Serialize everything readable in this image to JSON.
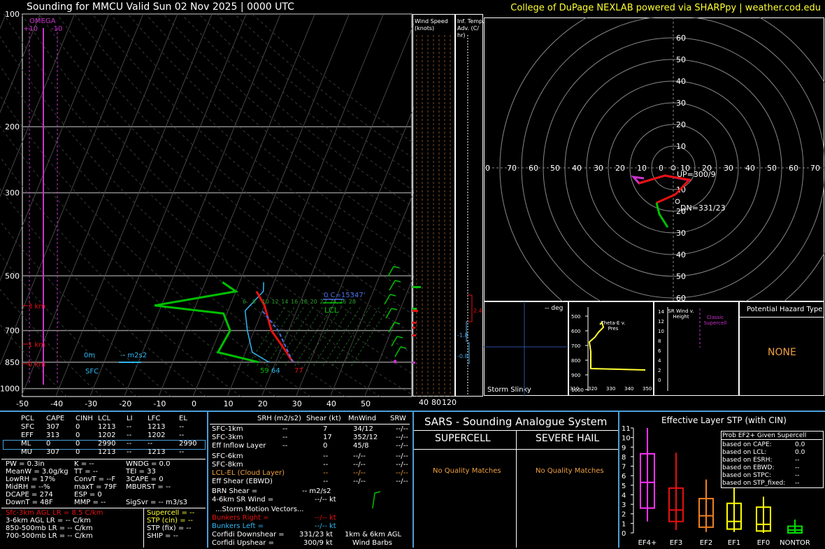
{
  "header": {
    "title": "Sounding for MMCU Valid  Sun 02 Nov 2025 | 0000 UTC",
    "credit": "College of DuPage NEXLAB powered via SHARPpy | weather.cod.edu"
  },
  "skewt": {
    "pressure_labels": [
      "100",
      "200",
      "300",
      "500",
      "700",
      "850",
      "1000"
    ],
    "temp_labels": [
      "-50",
      "-40",
      "-30",
      "-20",
      "-10",
      "0",
      "10",
      "20",
      "30",
      "40",
      "50"
    ],
    "omega_label": "OMEGA",
    "omega_ticks": [
      "+10",
      "-10"
    ],
    "height_labels": [
      "3 km",
      "1 km",
      "0 km"
    ],
    "hgt_0m": "0m",
    "sfc": "SFC",
    "srh_label": "-- m2s2",
    "freezing_label": "0 C=15347'",
    "lcl_label": "LCL",
    "surface_td": "59",
    "surface_t_wb": "64",
    "surface_t": "77",
    "mixratio_labels": [
      "6",
      "8",
      "10",
      "12",
      "14",
      "16",
      "18",
      "20",
      "22",
      "24",
      "26",
      "28"
    ]
  },
  "wind_speed": {
    "title1": "Wind Speed",
    "title2": "(knots)",
    "labels": [
      "40",
      "80",
      "120"
    ]
  },
  "temp_adv": {
    "title1": "Inf. Temp.",
    "title2": "Adv. (C/",
    "title3": "hr)",
    "values": [
      "2.4",
      "-1.8",
      "-0.8"
    ]
  },
  "hodograph": {
    "rings": [
      "10",
      "20",
      "30",
      "40",
      "50",
      "60"
    ],
    "x_labels": [
      "0",
      "70",
      "60",
      "50",
      "40",
      "30",
      "20",
      "10",
      "0",
      "10",
      "20",
      "30",
      "40",
      "50",
      "60",
      "70",
      "80"
    ],
    "up_label": "UP=300/9",
    "dn_label": "DN=331/23"
  },
  "slinky": {
    "deg": "-- deg",
    "label": "Storm Slinky"
  },
  "thetae": {
    "title": "Theta-E v. Pres",
    "y_labels": [
      "500",
      "600",
      "700",
      "800",
      "900",
      "1000"
    ],
    "x_labels": [
      "310",
      "320",
      "330",
      "340",
      "350"
    ]
  },
  "srwind": {
    "title": "SR Wind v. Height",
    "y_labels": [
      "14",
      "12",
      "10",
      "8",
      "6",
      "4",
      "2",
      "0"
    ],
    "classic": "Classic Supercell"
  },
  "hazard": {
    "title": "Potential Hazard Type",
    "value": "NONE"
  },
  "parcels": {
    "headers": [
      "PCL",
      "CAPE",
      "CINH",
      "LCL",
      "LI",
      "LFC",
      "EL"
    ],
    "rows": [
      [
        "SFC",
        "307",
        "0",
        "1213",
        "--",
        "1213",
        "--"
      ],
      [
        "EFF",
        "313",
        "0",
        "1202",
        "--",
        "1202",
        "--"
      ],
      [
        "ML",
        "0",
        "0",
        "2990",
        "--",
        "--",
        "2990"
      ],
      [
        "MU",
        "307",
        "0",
        "1213",
        "--",
        "1213",
        "--"
      ]
    ]
  },
  "indices": {
    "col1": [
      "PW = 0.3in",
      "MeanW = 3.0g/kg",
      "LowRH = 17%",
      "MidRH = --%",
      "DCAPE = 274",
      "DownT = 48F"
    ],
    "col2": [
      "K = --",
      "TT = --",
      "ConvT = --F",
      "maxT = 79F",
      "ESP = 0",
      "MMP = --"
    ],
    "col3": [
      "WNDG = 0.0",
      "TEI = 33",
      "3CAPE = 0",
      "MBURST = --",
      "",
      "SigSvr = -- m3/s3"
    ],
    "lapse": [
      "Sfc-3km AGL LR = 8.5 C/km",
      "3-6km AGL LR = -- C/km",
      "850-500mb LR = -- C/km",
      "700-500mb LR = -- C/km"
    ],
    "composites": [
      "Supercell = --",
      "STP (cin) = --",
      "STP (fix) = --",
      "SHIP = --"
    ]
  },
  "kinematics": {
    "headers": [
      "SRH (m2/s2)",
      "Shear (kt)",
      "MnWind",
      "SRW"
    ],
    "rows": [
      [
        "SFC-1km",
        "--",
        "7",
        "34/12",
        "--/--"
      ],
      [
        "SFC-3km",
        "--",
        "17",
        "352/12",
        "--/--"
      ],
      [
        "Eff Inflow Layer",
        "--",
        "0",
        "45/8",
        "--/--"
      ],
      [
        "SFC-6km",
        "",
        "--",
        "--/--",
        "--/--"
      ],
      [
        "SFC-8km",
        "",
        "--",
        "--/--",
        "--/--"
      ],
      [
        "LCL-EL (Cloud Layer)",
        "",
        "--",
        "--/--",
        "--/--"
      ],
      [
        "Eff Shear (EBWD)",
        "",
        "--",
        "--/--",
        "--/--"
      ]
    ],
    "brn": "BRN Shear =",
    "brn_val": "-- m2/s2",
    "srwind46": "4-6km SR Wind =",
    "srwind46_val": "--/-- kt",
    "storm_motion": "...Storm Motion Vectors...",
    "bunkers_right": "Bunkers Right =",
    "bunkers_right_val": "--/-- kt",
    "bunkers_left": "Bunkers Left =",
    "bunkers_left_val": "--/-- kt",
    "corfidi_down": "Corfidi Downshear =",
    "corfidi_down_val": "331/23 kt",
    "corfidi_up": "Corfidi Upshear =",
    "corfidi_up_val": "300/9 kt",
    "barbs_label1": "1km & 6km AGL",
    "barbs_label2": "Wind Barbs"
  },
  "sars": {
    "title": "SARS - Sounding Analogue System",
    "supercell": "SUPERCELL",
    "hail": "SEVERE HAIL",
    "supercell_match": "No Quality Matches",
    "hail_match": "No Quality Matches"
  },
  "stp": {
    "title": "Effective Layer STP (with CIN)",
    "y_labels": [
      "11",
      "10",
      "9",
      "8",
      "7",
      "6",
      "5",
      "4",
      "3",
      "2",
      "1",
      "0"
    ],
    "categories": [
      "EF4+",
      "EF3",
      "EF2",
      "EF1",
      "EF0",
      "NONTOR"
    ],
    "prob_title": "Prob EF2+ Given Supercell",
    "prob_rows": [
      [
        "based on CAPE:",
        "0.0"
      ],
      [
        "based on LCL:",
        "0.0"
      ],
      [
        "based on ESRH:",
        "--"
      ],
      [
        "based on EBWD:",
        "--"
      ],
      [
        "based on STPC:",
        "--"
      ],
      [
        "based on STP_fixed:",
        "--"
      ]
    ]
  },
  "colors": {
    "temp": "#e81010",
    "dewpoint": "#00c000",
    "wetbulb": "#30b8f0",
    "accent_yellow": "#ffff33",
    "omega": "#cc33cc",
    "panel_border": "#4a9fd8"
  },
  "chart_data": [
    {
      "type": "line",
      "title": "Sounding for MMCU Valid  Sun 02 Nov 2025 | 0000 UTC",
      "xlabel": "",
      "ylabel": "",
      "ylim": [
        1050,
        100
      ],
      "xlim": [
        -50,
        50
      ],
      "series": [
        {
          "name": "Temperature",
          "points": [
            [
              25,
              850
            ],
            [
              22,
              800
            ],
            [
              15,
              700
            ],
            [
              10,
              600
            ],
            [
              6,
              550
            ]
          ]
        },
        {
          "name": "Dewpoint",
          "points": [
            [
              15,
              850
            ],
            [
              2,
              800
            ],
            [
              3,
              700
            ],
            [
              -1,
              630
            ],
            [
              -22,
              600
            ],
            [
              0,
              550
            ],
            [
              -5,
              520
            ]
          ]
        },
        {
          "name": "Wetbulb",
          "points": [
            [
              18,
              850
            ],
            [
              12,
              800
            ],
            [
              8,
              700
            ],
            [
              5,
              620
            ],
            [
              8,
              550
            ],
            [
              7,
              520
            ]
          ]
        }
      ]
    },
    {
      "type": "bar",
      "title": "Effective Layer STP (with CIN)",
      "categories": [
        "EF4+",
        "EF3",
        "EF2",
        "EF1",
        "EF0",
        "NONTOR"
      ],
      "series": [
        {
          "name": "min",
          "values": [
            1.2,
            0.3,
            0.1,
            0.1,
            0.0,
            0.0
          ]
        },
        {
          "name": "q1",
          "values": [
            2.6,
            1.2,
            0.6,
            0.4,
            0.2,
            0.0
          ]
        },
        {
          "name": "median",
          "values": [
            5.3,
            2.4,
            1.8,
            1.2,
            0.9,
            0.3
          ]
        },
        {
          "name": "q3",
          "values": [
            8.3,
            4.7,
            3.6,
            3.1,
            2.7,
            0.7
          ]
        },
        {
          "name": "max",
          "values": [
            11.0,
            8.4,
            5.6,
            4.8,
            3.8,
            1.4
          ]
        }
      ],
      "ylim": [
        0,
        11
      ]
    }
  ]
}
